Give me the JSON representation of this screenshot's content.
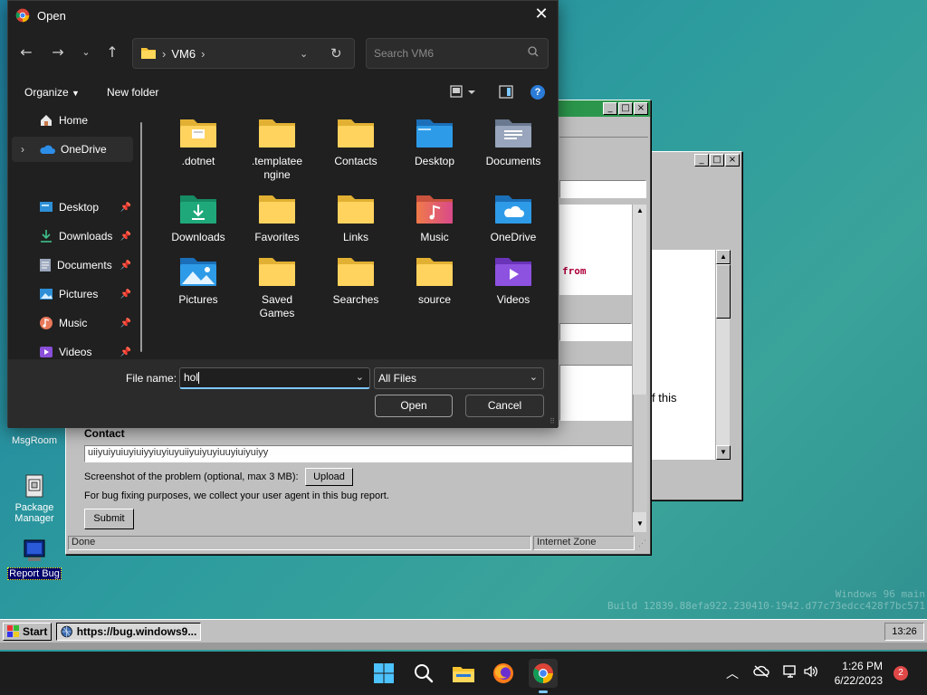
{
  "dialog": {
    "title": "Open",
    "address_crumbs": [
      "VM6"
    ],
    "search_placeholder": "Search VM6",
    "toolbar": {
      "organize": "Organize",
      "new_folder": "New folder"
    },
    "nav": {
      "home": "Home",
      "onedrive": "OneDrive",
      "desktop": "Desktop",
      "downloads": "Downloads",
      "documents": "Documents",
      "pictures": "Pictures",
      "music": "Music",
      "videos": "Videos"
    },
    "items": [
      {
        "name": ".dotnet",
        "icon": "folder-dotnet-icon"
      },
      {
        "name": ".templatee ngine",
        "icon": "folder-icon"
      },
      {
        "name": "Contacts",
        "icon": "folder-icon"
      },
      {
        "name": "Desktop",
        "icon": "desktop-folder-icon"
      },
      {
        "name": "Documents",
        "icon": "documents-folder-icon"
      },
      {
        "name": "Downloads",
        "icon": "downloads-folder-icon"
      },
      {
        "name": "Favorites",
        "icon": "folder-icon"
      },
      {
        "name": "Links",
        "icon": "folder-icon"
      },
      {
        "name": "Music",
        "icon": "music-folder-icon"
      },
      {
        "name": "OneDrive",
        "icon": "onedrive-folder-icon"
      },
      {
        "name": "Pictures",
        "icon": "pictures-folder-icon"
      },
      {
        "name": "Saved Games",
        "icon": "folder-icon"
      },
      {
        "name": "Searches",
        "icon": "folder-icon"
      },
      {
        "name": "source",
        "icon": "folder-icon"
      },
      {
        "name": "Videos",
        "icon": "videos-folder-icon"
      }
    ],
    "file_name_label": "File name:",
    "file_name_value": "hol",
    "file_type": "All Files",
    "open_button": "Open",
    "cancel_button": "Cancel"
  },
  "browser_window": {
    "from_text": "from",
    "contact_label": "Contact",
    "contact_value": "uiiyuiyuiuyiuiyyiuyiuyuiiyuiyuyiuuyiuiyuiyy",
    "screenshot_label": "Screenshot of the problem (optional, max 3 MB):",
    "upload_button": "Upload",
    "user_agent_note": "For bug fixing purposes, we collect your user agent in this bug report.",
    "submit_button": "Submit",
    "status_done": "Done",
    "status_zone": "Internet Zone"
  },
  "second_window": {
    "text": "f this"
  },
  "desktop_icons": [
    {
      "label": "MsgRoom"
    },
    {
      "label": "Package Manager"
    },
    {
      "label": "Report Bug"
    }
  ],
  "watermark": {
    "line1": "Windows 96 main",
    "line2": "Build 12839.88efa922.230410-1942.d77c73edcc428f7bc571"
  },
  "taskbar96": {
    "start": "Start",
    "task": "https://bug.windows9...",
    "clock": "13:26"
  },
  "taskbar11": {
    "time": "1:26 PM",
    "date": "6/22/2023",
    "notifications": "2"
  }
}
